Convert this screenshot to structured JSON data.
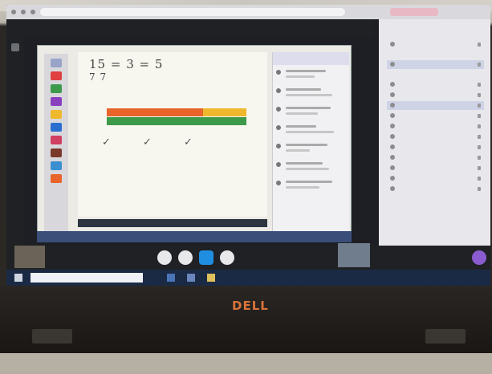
{
  "browser": {
    "url": ""
  },
  "meeting": {
    "title": ""
  },
  "whiteboard": {
    "equation": "15 = 3 = 5",
    "equation_sub": "7    7",
    "checks": "✓ ✓ ✓"
  },
  "chat": {
    "header": ""
  },
  "people_panel": {
    "title": "",
    "host": "",
    "participants": [
      "",
      "",
      "",
      "",
      "",
      "",
      "",
      "",
      "",
      "",
      "",
      "",
      ""
    ]
  },
  "windows": {
    "search_placeholder": ""
  },
  "laptop": {
    "brand": "DELL"
  },
  "colors": {
    "bar_orange": "#e8642a",
    "bar_yellow": "#f0b82d",
    "bar_green": "#3c9a4a",
    "meet_red": "#e34b3c",
    "meet_blue": "#1f8ee0",
    "meet_green": "#2d9b6a",
    "dell_logo": "#d8733a"
  }
}
